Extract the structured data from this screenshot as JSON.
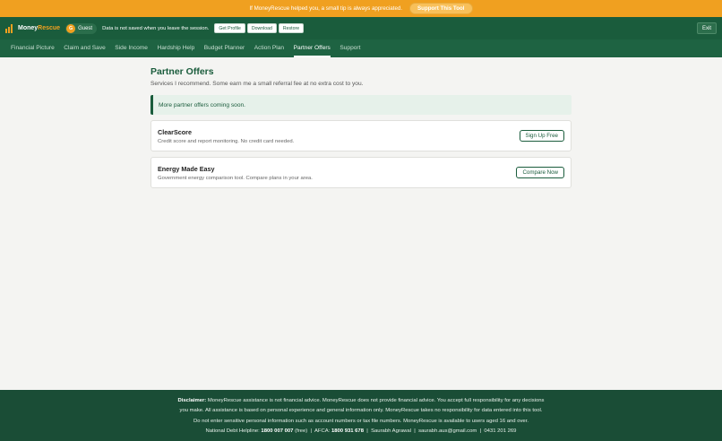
{
  "tipbar": {
    "message": "If MoneyRescue helped you, a small tip is always appreciated.",
    "button": "Support This Tool"
  },
  "header": {
    "brand_part1": "Money",
    "brand_part2": "Rescue",
    "user_initial": "G",
    "user_name": "Guest",
    "notice": "Data is not saved when you leave the session.",
    "buttons": [
      "Get Profile",
      "Download",
      "Restore"
    ],
    "exit": "Exit"
  },
  "nav": {
    "tabs": [
      "Financial Picture",
      "Claim and Save",
      "Side Income",
      "Hardship Help",
      "Budget Planner",
      "Action Plan",
      "Partner Offers",
      "Support"
    ],
    "active_tab": "Partner Offers"
  },
  "main": {
    "title": "Partner Offers",
    "subtitle": "Services I recommend. Some earn me a small referral fee at no extra cost to you.",
    "coming_soon": "More partner offers coming soon.",
    "offers": [
      {
        "name": "ClearScore",
        "desc": "Credit score and report monitoring. No credit card needed.",
        "button": "Sign Up Free"
      },
      {
        "name": "Energy Made Easy",
        "desc": "Government energy comparison tool. Compare plans in your area.",
        "button": "Compare Now"
      }
    ]
  },
  "footer": {
    "disclaimer_label": "Disclaimer:",
    "line1": " MoneyRescue assistance is not financial advice. MoneyRescue does not provide financial advice. You accept full responsibility for any decisions",
    "line2": "you make. All assistance is based on personal experience and general information only. MoneyRescue takes no responsibility for data entered into this tool.",
    "line3": "Do not enter sensitive personal information such as account numbers or tax file numbers. MoneyRescue is available to users aged 16 and over.",
    "helpline_label": "National Debt Helpline:",
    "helpline_number": "1800 007 007",
    "helpline_note": "(free)",
    "afca_label": "AFCA:",
    "afca_number": "1800 931 678",
    "author": "Saurabh Agrawal",
    "email": "saurabh.aus@gmail.com",
    "phone": "0431 201 269",
    "separator": "|"
  },
  "colors": {
    "accent": "#f0a020",
    "brand_green": "#1a5c3c",
    "footer_bg": "#1a4d36"
  }
}
